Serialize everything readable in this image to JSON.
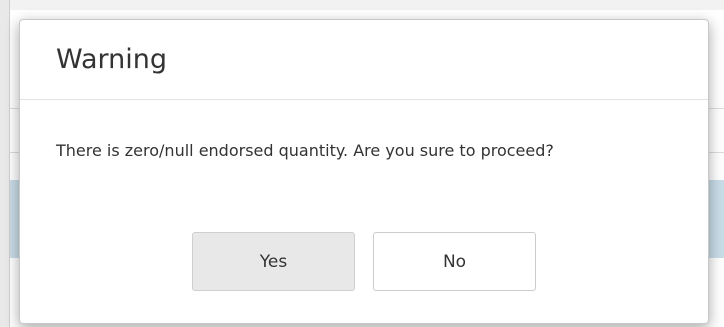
{
  "dialog": {
    "title": "Warning",
    "message": "There is zero/null endorsed quantity. Are you sure to proceed?",
    "buttons": {
      "yes_label": "Yes",
      "no_label": "No"
    }
  },
  "colors": {
    "background_band": "#c9dde8",
    "yes_button_bg": "#e8e8e8",
    "no_button_bg": "#ffffff",
    "text": "#333333"
  }
}
